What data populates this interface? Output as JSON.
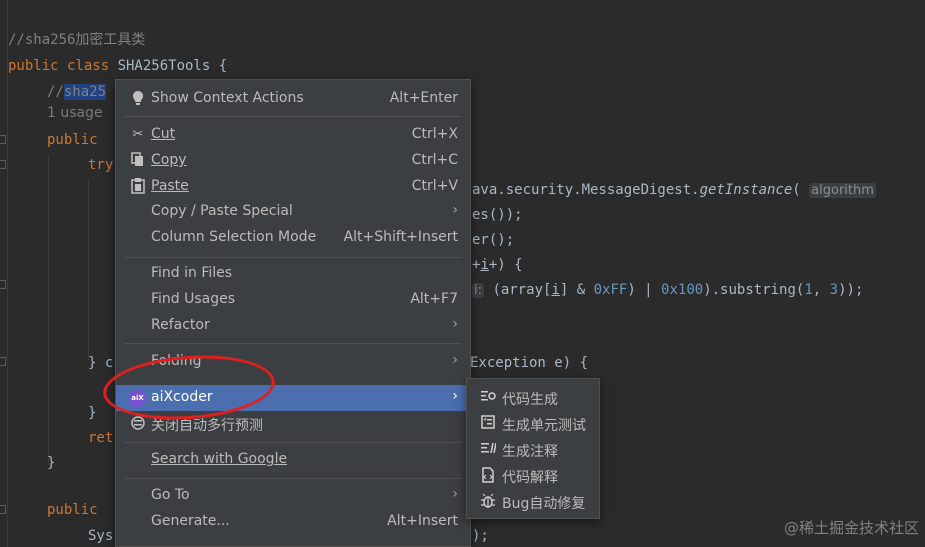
{
  "editor": {
    "comment_header": "//sha256加密工具类",
    "class_decl": {
      "kw": "public class ",
      "name": "SHA256Tools {"
    },
    "line_comment_prefix": "//",
    "line_comment_selected": "sha25",
    "usage_hint": "1 usage",
    "public_kw": "public",
    "try_kw": "try",
    "msgdigest_tail": "ava.security.MessageDigest.",
    "get_instance": "getInstance",
    "paren_open": "(",
    "algorithm_hint": "algorithm",
    "bytes_tail": "es());",
    "er_tail": "er();",
    "loop_tail": "++i) {",
    "loop_i": "i",
    "array_part": "(array[",
    "array_i": "i",
    "array_rest": "] & ",
    "hex_ff": "0xFF",
    "pipe": ") | ",
    "hex_100": "0x100",
    "substring_part": ").substring(",
    "num_1": "1",
    "comma": ", ",
    "num_3": "3",
    "substring_close": "));",
    "close_brace_c": "} c",
    "exception_tail": "Exception e) {",
    "close_brace": "}",
    "ret_kw": "ret",
    "close_brace_2": "}",
    "public_kw_2": "public",
    "sys_text": "Sys",
    "close_paren_semi": ");"
  },
  "context_menu": {
    "items": [
      {
        "label": "Show Context Actions",
        "shortcut": "Alt+Enter",
        "icon": "bulb-icon"
      },
      {
        "label": "Cut",
        "shortcut": "Ctrl+X",
        "icon": "scissors-icon"
      },
      {
        "label": "Copy",
        "shortcut": "Ctrl+C",
        "icon": "copy-icon"
      },
      {
        "label": "Paste",
        "shortcut": "Ctrl+V",
        "icon": "clipboard-icon"
      },
      {
        "label": "Copy / Paste Special",
        "icon": ""
      },
      {
        "label": "Column Selection Mode",
        "shortcut": "Alt+Shift+Insert",
        "icon": ""
      },
      {
        "label": "Find in Files",
        "icon": ""
      },
      {
        "label": "Find Usages",
        "shortcut": "Alt+F7",
        "icon": ""
      },
      {
        "label": "Refactor",
        "icon": ""
      },
      {
        "label": "Folding",
        "icon": ""
      },
      {
        "label": "aiXcoder",
        "icon": "aixcoder-logo-icon"
      },
      {
        "label": "关闭自动多行预测",
        "icon": "toggle-icon"
      },
      {
        "label": "Search with Google",
        "icon": ""
      },
      {
        "label": "Go To",
        "icon": ""
      },
      {
        "label": "Generate...",
        "shortcut": "Alt+Insert",
        "icon": ""
      }
    ],
    "arrow": "›"
  },
  "submenu": {
    "items": [
      {
        "label": "代码生成",
        "icon": "code-gen-icon"
      },
      {
        "label": "生成单元测试",
        "icon": "unit-test-icon"
      },
      {
        "label": "生成注释",
        "icon": "comment-gen-icon"
      },
      {
        "label": "代码解释",
        "icon": "code-explain-icon"
      },
      {
        "label": "Bug自动修复",
        "icon": "bug-fix-icon"
      }
    ]
  },
  "watermark": "@稀土掘金技术社区",
  "colors": {
    "menu_bg": "#3c3f41",
    "highlight": "#4b6eaf",
    "editor_bg": "#2b2b2b",
    "annotation": "#e02020"
  }
}
